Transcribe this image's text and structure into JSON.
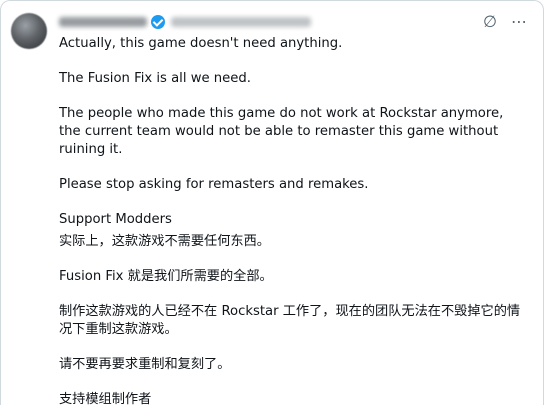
{
  "post": {
    "author": {
      "display_name": "",
      "handle": "",
      "verified": true,
      "avatar": "blurred-avatar"
    },
    "icons": {
      "no_translate": "∅",
      "more": "⋯"
    },
    "colors": {
      "verified": "#1d9bf0",
      "text": "#0f1419",
      "muted": "#536471",
      "border": "#cfd9de"
    },
    "paragraphs": [
      "Actually, this game doesn't need anything.",
      "The Fusion Fix is all we need.",
      "The people who made this game do not work at Rockstar anymore, the current team would not be able to remaster this game without ruining it.",
      "Please stop asking for remasters and remakes.",
      "Support Modders",
      "实际上，这款游戏不需要任何东西。",
      "Fusion Fix 就是我们所需要的全部。",
      "制作这款游戏的人已经不在 Rockstar 工作了，现在的团队无法在不毁掉它的情况下重制这款游戏。",
      "请不要再要求重制和复刻了。",
      "支持模组制作者"
    ]
  }
}
